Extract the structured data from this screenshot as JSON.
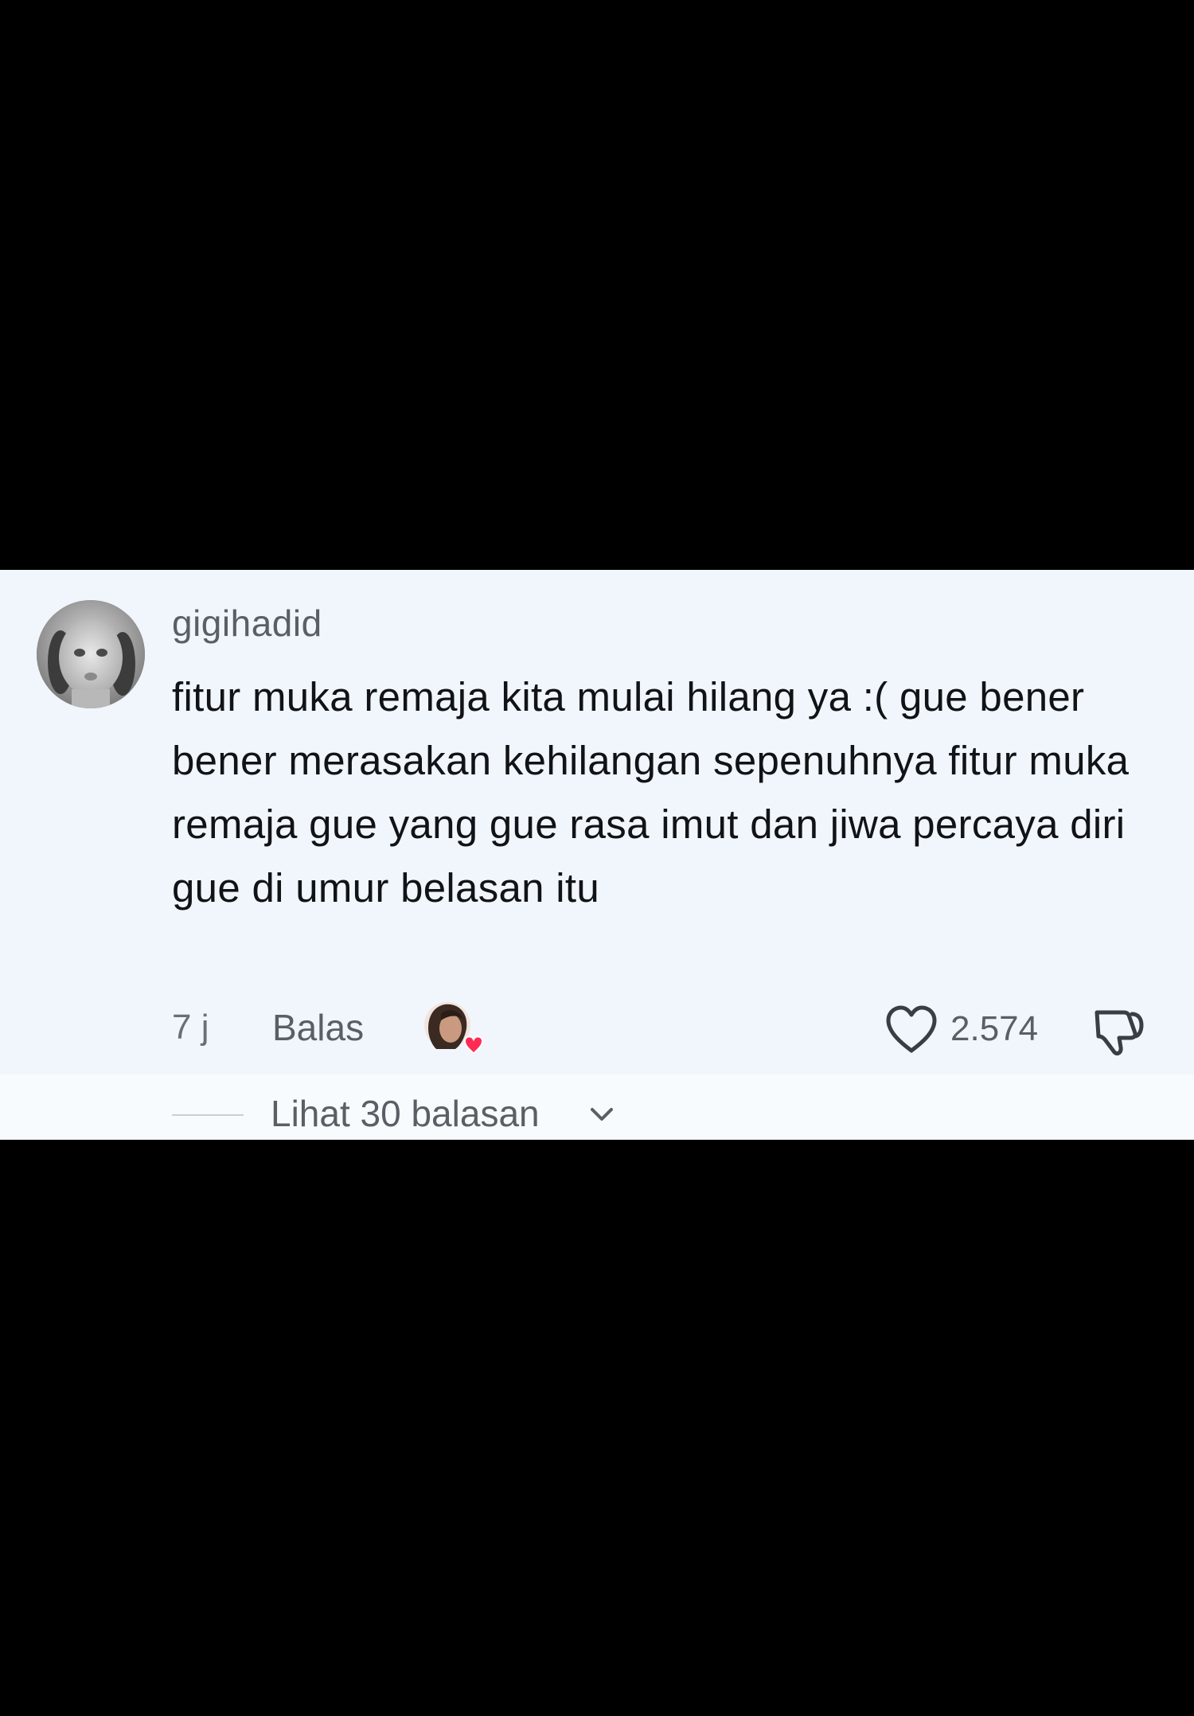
{
  "comment": {
    "username": "gigihadid",
    "text": "fitur muka remaja kita mulai hilang ya :( gue bener bener merasakan kehilangan sepenuhnya fitur muka remaja gue yang gue rasa imut dan jiwa percaya diri gue di umur belasan itu",
    "timestamp": "7 j",
    "reply_label": "Balas",
    "like_count": "2.574",
    "view_replies_label": "Lihat 30 balasan"
  },
  "icons": {
    "avatar": "avatar",
    "creator_liked": "creator-liked-heart-icon",
    "like": "heart-outline-icon",
    "dislike": "thumbs-down-icon",
    "expand": "chevron-down-icon"
  },
  "colors": {
    "background": "#000000",
    "card": "#f0f6fb",
    "text_primary": "#111317",
    "text_secondary": "#5a5f66",
    "heart_badge": "#fe2c55"
  }
}
